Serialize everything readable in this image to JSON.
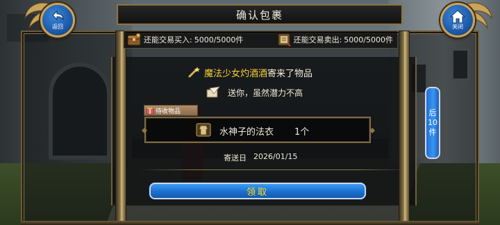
{
  "window": {
    "title": "确认包裹"
  },
  "nav": {
    "back_label": "返回",
    "close_label": "关闭"
  },
  "trade": {
    "buy": {
      "label": "还能交易买入:",
      "value": "5000/5000件"
    },
    "sell": {
      "label": "还能交易卖出:",
      "value": "5000/5000件"
    }
  },
  "parcel": {
    "sender_name": "魔法少女灼酒酒",
    "sender_suffix": "寄来了物品",
    "message": "送你，虽然潜力不高",
    "pending_label": "待收物品",
    "item_name": "水神子的法衣",
    "item_qty": "1个",
    "send_date_label": "寄送日",
    "send_date": "2026/01/15"
  },
  "actions": {
    "claim_label": "领取",
    "next_label_top": "后",
    "next_label_mid": "10",
    "next_label_bottom": "件"
  },
  "colors": {
    "accent_blue": "#1a6fd0",
    "frame_gold": "#8d7748",
    "highlight_yellow": "#f7d23a"
  }
}
